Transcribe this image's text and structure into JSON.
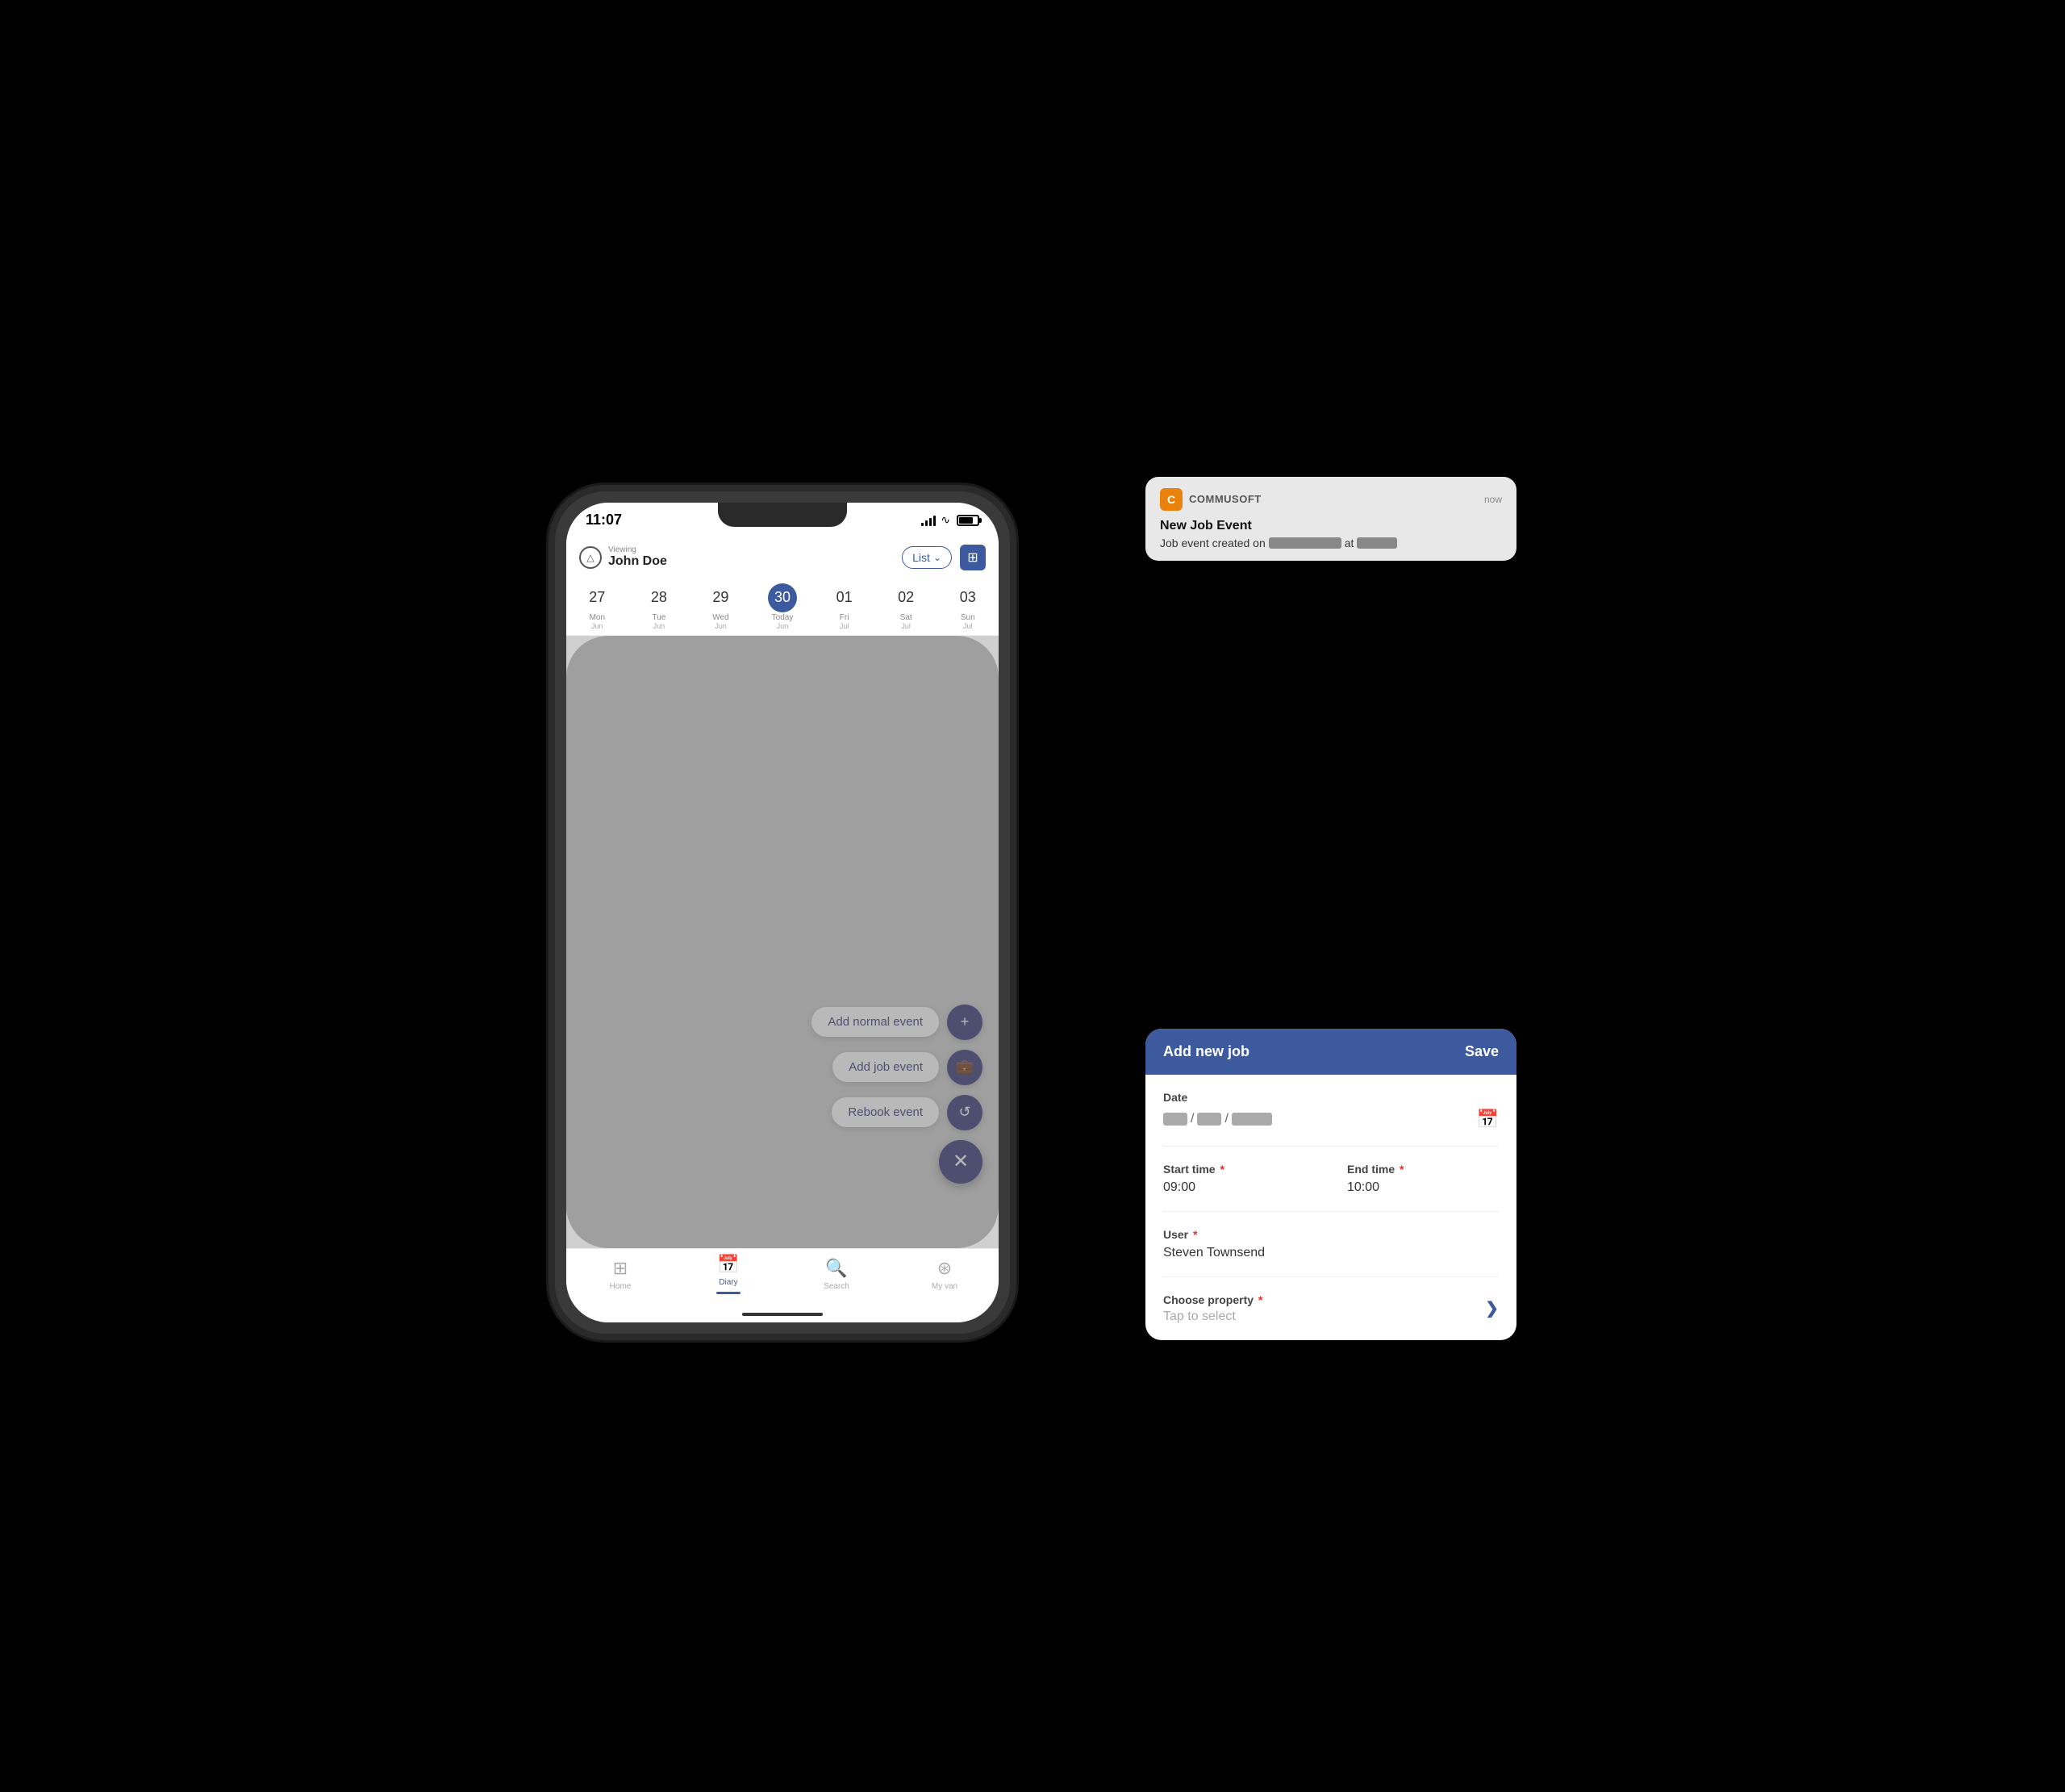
{
  "phone": {
    "statusBar": {
      "time": "11:07"
    },
    "header": {
      "viewingLabel": "Viewing",
      "userName": "John Doe",
      "listLabel": "List",
      "calendarIcon": "grid-icon"
    },
    "dateStrip": {
      "dates": [
        {
          "num": "27",
          "day": "Mon",
          "month": "Jun",
          "today": false
        },
        {
          "num": "28",
          "day": "Tue",
          "month": "Jun",
          "today": false
        },
        {
          "num": "29",
          "day": "Wed",
          "month": "Jun",
          "today": false
        },
        {
          "num": "30",
          "day": "Today",
          "month": "Jun",
          "today": true
        },
        {
          "num": "01",
          "day": "Fri",
          "month": "Jul",
          "today": false
        },
        {
          "num": "02",
          "day": "Sat",
          "month": "Jul",
          "today": false
        },
        {
          "num": "03",
          "day": "Sun",
          "month": "Jul",
          "today": false
        }
      ]
    },
    "fabButtons": [
      {
        "label": "Add normal event",
        "icon": "+"
      },
      {
        "label": "Add job event",
        "icon": "💼"
      },
      {
        "label": "Rebook event",
        "icon": "↺"
      }
    ],
    "fabCloseIcon": "×",
    "bottomNav": [
      {
        "label": "Home",
        "icon": "⊞",
        "active": false
      },
      {
        "label": "Diary",
        "icon": "📅",
        "active": true
      },
      {
        "label": "Search",
        "icon": "🔍",
        "active": false
      },
      {
        "label": "My van",
        "icon": "⊛",
        "active": false
      }
    ]
  },
  "notification": {
    "appIcon": "C",
    "appName": "COMMUSOFT",
    "time": "now",
    "title": "New Job Event",
    "body": "Job event created on",
    "atLabel": "at"
  },
  "jobPanel": {
    "title": "Add new job",
    "saveLabel": "Save",
    "fields": {
      "date": {
        "label": "Date",
        "calendarIcon": "calendar-icon"
      },
      "startTime": {
        "label": "Start time",
        "required": true,
        "value": "09:00"
      },
      "endTime": {
        "label": "End time",
        "required": true,
        "value": "10:00"
      },
      "user": {
        "label": "User",
        "required": true,
        "value": "Steven Townsend"
      },
      "chooseProperty": {
        "label": "Choose property",
        "required": true,
        "placeholder": "Tap to select"
      }
    }
  }
}
